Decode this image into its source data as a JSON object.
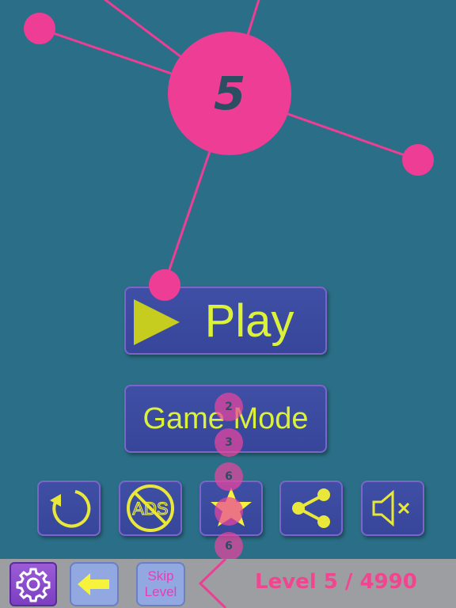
{
  "game": {
    "center_number": "5",
    "pin_labels": [
      "2",
      "3",
      "6",
      "6"
    ],
    "colors": {
      "background": "#2a6f87",
      "pink": "#ee3d95",
      "button": "#3f4fa5",
      "button_border": "#7d64c9",
      "button_text": "#dcf23a",
      "bottom_bar": "#9c9ea1"
    }
  },
  "menu": {
    "play_label": "Play",
    "game_mode_label": "Game Mode"
  },
  "icon_row": [
    {
      "name": "restart-icon"
    },
    {
      "name": "no-ads-icon",
      "text": "ADS"
    },
    {
      "name": "star-icon"
    },
    {
      "name": "share-icon"
    },
    {
      "name": "mute-icon"
    }
  ],
  "bottom_bar": {
    "skip_label_line1": "Skip",
    "skip_label_line2": "Level",
    "level_text": "Level 5 / 4990"
  }
}
